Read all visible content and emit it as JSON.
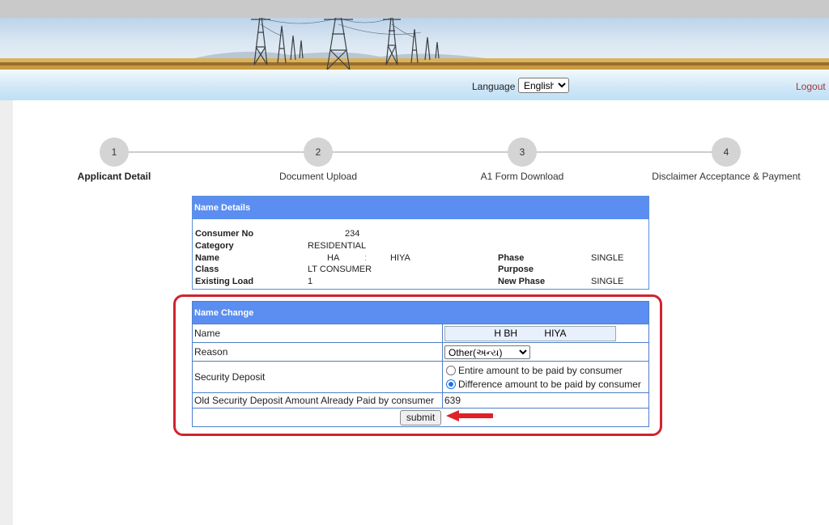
{
  "header": {
    "language_label": "Language :",
    "language_selected": "English",
    "logout_label": "Logout"
  },
  "steps": [
    {
      "number": "1",
      "label": "Applicant Detail",
      "active": true
    },
    {
      "number": "2",
      "label": "Document Upload",
      "active": false
    },
    {
      "number": "3",
      "label": "A1 Form Download",
      "active": false
    },
    {
      "number": "4",
      "label": "Disclaimer Acceptance & Payment",
      "active": false
    }
  ],
  "name_details": {
    "title": "Name Details",
    "consumer_no_label": "Consumer No",
    "consumer_no_value": "234",
    "category_label": "Category",
    "category_value": "RESIDENTIAL",
    "name_label": "Name",
    "name_value_first": "HA",
    "name_value_mid": ":",
    "name_value_last": "HIYA",
    "class_label": "Class",
    "class_value": "LT CONSUMER",
    "existing_load_label": "Existing Load",
    "existing_load_value": "1",
    "phase_label": "Phase",
    "phase_value": "SINGLE",
    "purpose_label": "Purpose",
    "new_phase_label": "New Phase",
    "new_phase_value": "SINGLE"
  },
  "name_change": {
    "title": "Name Change",
    "name_label": "Name",
    "name_value": "H BH          HIYA",
    "reason_label": "Reason",
    "reason_selected": "Other(અન્ય)",
    "security_deposit_label": "Security Deposit",
    "deposit_option_1": "Entire amount to be paid by consumer",
    "deposit_option_2": "Difference amount to be paid by consumer",
    "deposit_selected": 2,
    "old_deposit_label": "Old Security Deposit Amount Already Paid by consumer",
    "old_deposit_value": "639",
    "submit_label": "submit"
  },
  "colors": {
    "panel_header": "#5b8ef0",
    "highlight_border": "#d0232e",
    "arrow": "#e0202a",
    "logout": "#a23a3a"
  }
}
